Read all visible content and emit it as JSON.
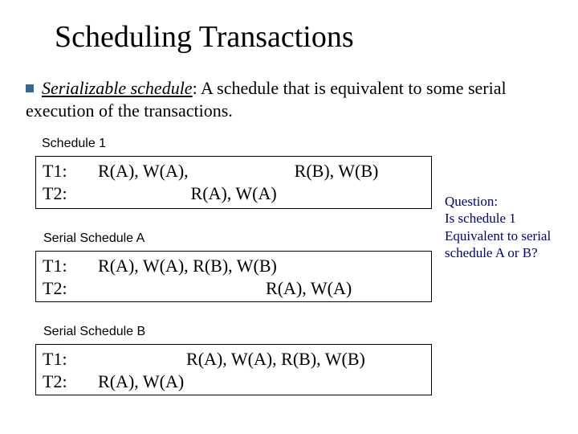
{
  "title": "Scheduling Transactions",
  "bullet": {
    "term": "Serializable schedule",
    "rest": ": A schedule that is equivalent to some serial execution of the transactions."
  },
  "labels": {
    "s1": "Schedule 1",
    "sa": "Serial Schedule A",
    "sb": "Serial Schedule B"
  },
  "box1": {
    "r1": "T1:       R(A), W(A),                        R(B), W(B)",
    "r2": "T2:                            R(A), W(A)"
  },
  "boxA": {
    "r1": "T1:       R(A), W(A), R(B), W(B)",
    "r2": "T2:                                             R(A), W(A)"
  },
  "boxB": {
    "r1": "T1:                           R(A), W(A), R(B), W(B)",
    "r2": "T2:       R(A), W(A)"
  },
  "question": {
    "l1": "Question:",
    "l2": "Is schedule 1",
    "l3": "Equivalent to serial",
    "l4": "schedule A or B?"
  }
}
